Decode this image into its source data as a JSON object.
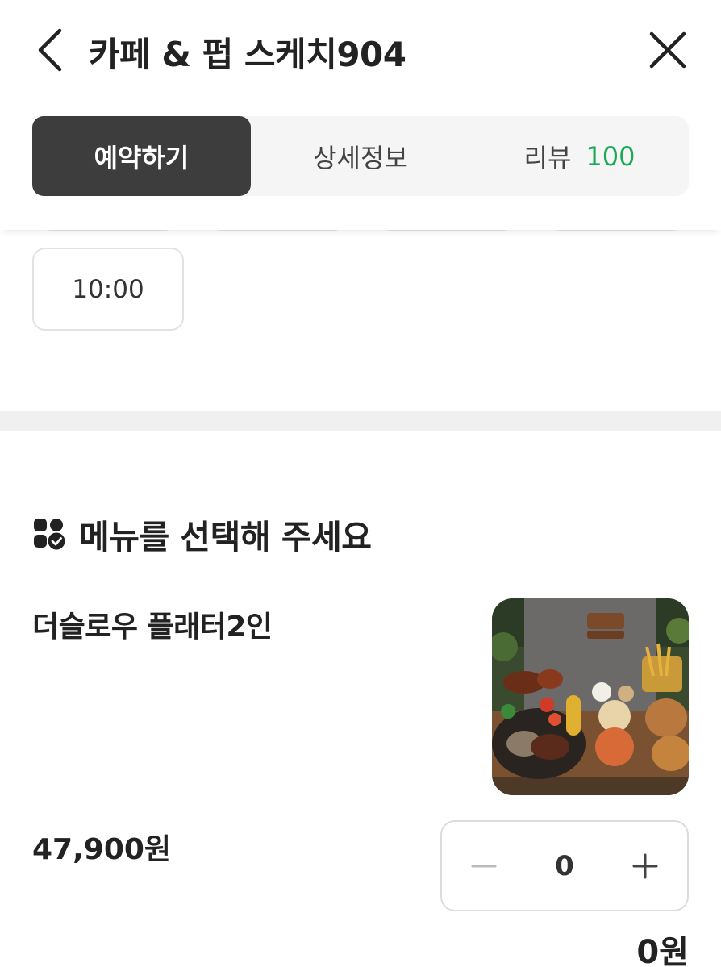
{
  "header": {
    "title": "카페 & 펍 스케치904",
    "back_icon": "chevron-left-icon",
    "close_icon": "close-icon"
  },
  "tabs": [
    {
      "label": "예약하기",
      "active": true
    },
    {
      "label": "상세정보",
      "active": false
    },
    {
      "label": "리뷰",
      "count": "100",
      "active": false
    }
  ],
  "colors": {
    "active_tab_bg": "#3d3d3d",
    "review_count": "#1aaa55",
    "divider": "#f0f0f0"
  },
  "time_slots": [
    {
      "label": "10:00"
    }
  ],
  "menu_section": {
    "icon": "menu-check-icon",
    "title": "메뉴를 선택해 주세요",
    "items": [
      {
        "name": "더슬로우 플래터2인",
        "price": "47,900원",
        "quantity": "0",
        "subtotal": "0원",
        "image": "food-platter-photo"
      }
    ]
  }
}
